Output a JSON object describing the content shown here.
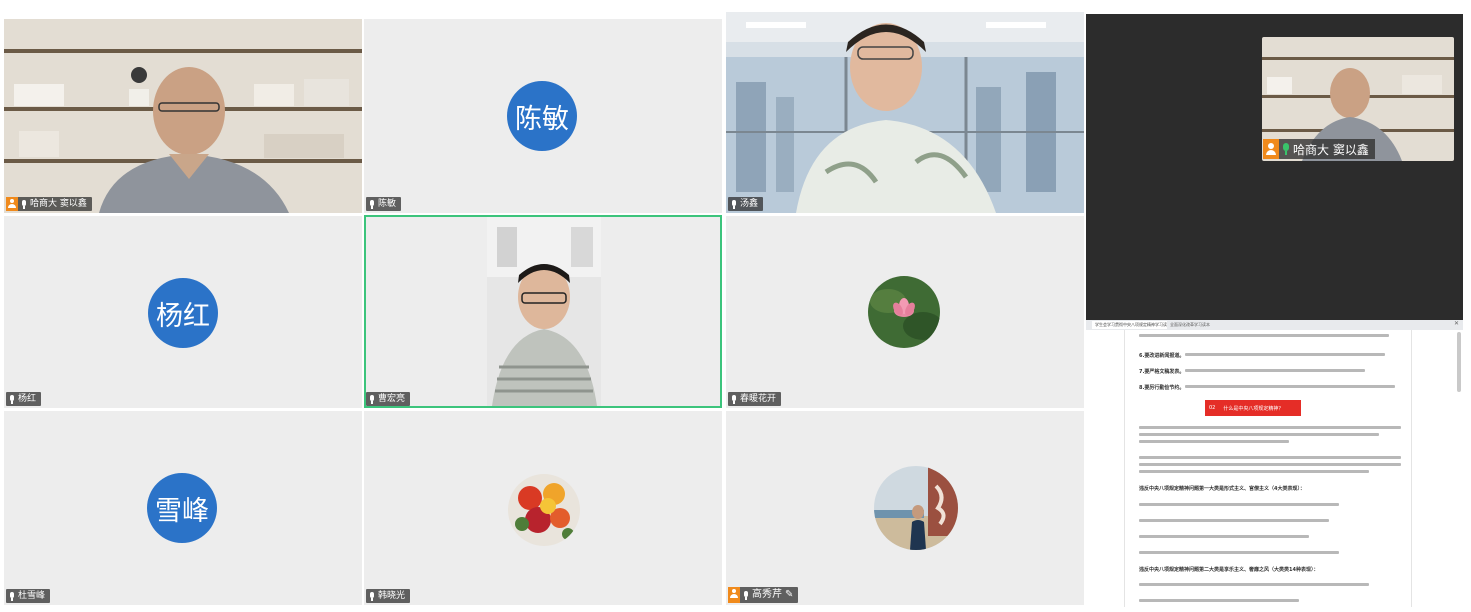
{
  "participants": [
    {
      "name": "哈商大 窦以鑫",
      "host": true,
      "video": true
    },
    {
      "name": "陈敏",
      "avatar_text": "陈敏",
      "host": false,
      "video": false
    },
    {
      "name": "汤鑫",
      "host": false,
      "video": true
    },
    {
      "name": "杨红",
      "avatar_text": "杨红",
      "host": false,
      "video": false
    },
    {
      "name": "曹宏亮",
      "host": false,
      "video": true,
      "active_speaker": true
    },
    {
      "name": "春暖花开",
      "host": false,
      "video": false,
      "avatar_icon": "lotus-photo"
    },
    {
      "name": "杜雪峰",
      "avatar_text": "雪峰",
      "host": false,
      "video": false
    },
    {
      "name": "韩晓光",
      "host": false,
      "video": false,
      "avatar_icon": "flowers-photo"
    },
    {
      "name": "高秀芹",
      "host": true,
      "video": false,
      "avatar_icon": "portrait-photo",
      "editing": true
    }
  ],
  "self_view": {
    "name": "哈商大 窦以鑫"
  },
  "shared_doc": {
    "tab1": "学生会学习贯彻中央八项规定精神学习读本",
    "tab2": "全面深化改革学习读本",
    "item6_title": "6.要改进新闻报道。",
    "item7_title": "7.要严格文稿发表。",
    "item8_title": "8.要厉行勤俭节约。",
    "section_badge_num": "02",
    "section_badge_text": "什么是中央八项规定精神？",
    "heading1": "违反中央八项规定精神问题第一大类是形式主义、官僚主义（4大类表现）：",
    "heading2": "违反中央八项规定精神问题第二大类是享乐主义、奢靡之风（大类类14种表现）："
  },
  "colors": {
    "avatar_blue": "#2b73c8",
    "active_speaker_border": "#3cc47c",
    "host_badge": "#f08a1c",
    "share_bg": "#2c2c2c",
    "doc_red": "#e52d27"
  }
}
